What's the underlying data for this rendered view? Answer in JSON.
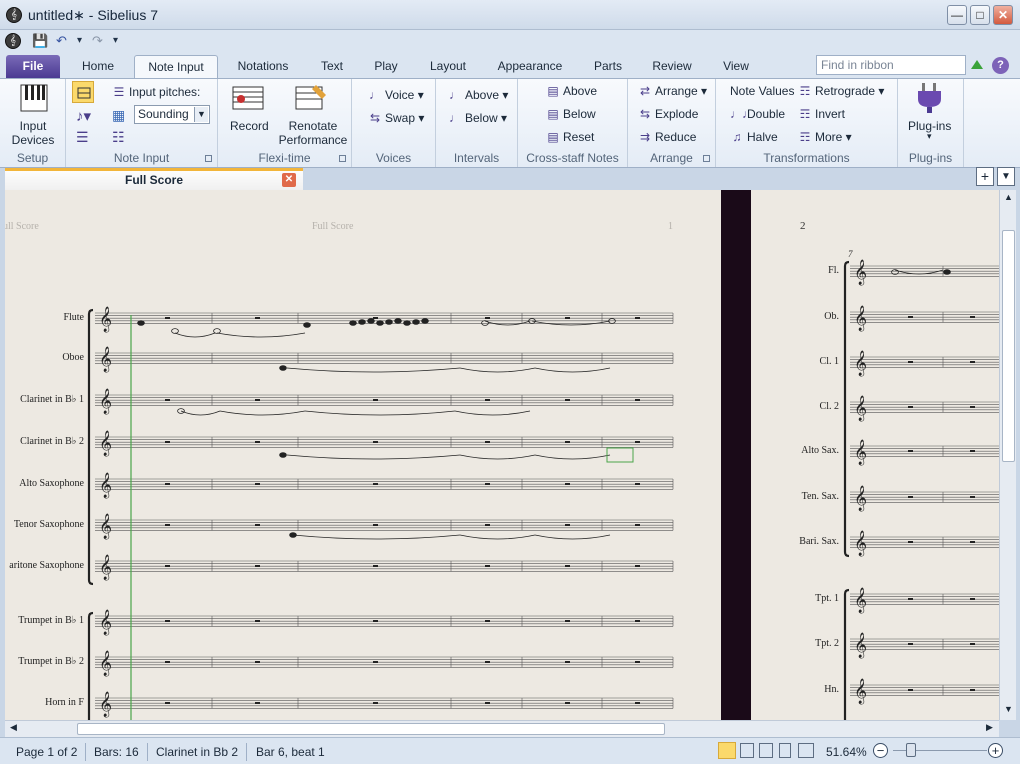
{
  "window": {
    "title": "untitled∗ - Sibelius 7",
    "minimize": "—",
    "maximize": "□",
    "close": "✕"
  },
  "qat": {
    "save": "💾",
    "undo": "↶",
    "redo": "↷",
    "dropdown": "▾"
  },
  "tabs": {
    "file": "File",
    "home": "Home",
    "note_input": "Note Input",
    "notations": "Notations",
    "text": "Text",
    "play": "Play",
    "layout": "Layout",
    "appearance": "Appearance",
    "parts": "Parts",
    "review": "Review",
    "view": "View"
  },
  "find": {
    "placeholder": "Find in ribbon"
  },
  "help": "?",
  "ribbon": {
    "setup": {
      "label": "Setup",
      "input_devices": "Input Devices"
    },
    "note_input": {
      "label": "Note Input",
      "input_pitches": "Input pitches:",
      "sounding": "Sounding"
    },
    "flexi": {
      "label": "Flexi-time",
      "record": "Record",
      "renotate": "Renotate Performance"
    },
    "voices": {
      "label": "Voices",
      "voice": "Voice",
      "swap": "Swap"
    },
    "intervals": {
      "label": "Intervals",
      "above": "Above",
      "below": "Below"
    },
    "cross_staff": {
      "label": "Cross-staff Notes",
      "above": "Above",
      "below": "Below",
      "reset": "Reset"
    },
    "arrange": {
      "label": "Arrange",
      "arrange": "Arrange",
      "explode": "Explode",
      "reduce": "Reduce"
    },
    "transformations": {
      "label": "Transformations",
      "note_values": "Note Values",
      "double": "Double",
      "halve": "Halve",
      "retrograde": "Retrograde",
      "invert": "Invert",
      "more": "More"
    },
    "plugins": {
      "label": "Plug-ins",
      "plugins": "Plug-ins"
    }
  },
  "doc_tab": {
    "title": "Full Score",
    "close": "✕"
  },
  "side": {
    "add": "+",
    "menu": "▼"
  },
  "score": {
    "page1_header_left": "ull Score",
    "page1_header_center": "Full Score",
    "page1_number": "1",
    "page2_number": "2",
    "bar_number": "7",
    "page1_instruments": [
      "Flute",
      "Oboe",
      "Clarinet in B♭ 1",
      "Clarinet in B♭ 2",
      "Alto Saxophone",
      "Tenor Saxophone",
      "aritone Saxophone",
      "Trumpet in B♭ 1",
      "Trumpet in B♭ 2",
      "Horn in F"
    ],
    "page2_instruments": [
      "Fl.",
      "Ob.",
      "Cl. 1",
      "Cl. 2",
      "Alto Sax.",
      "Ten. Sax.",
      "Bari. Sax.",
      "Tpt. 1",
      "Tpt. 2",
      "Hn."
    ]
  },
  "status": {
    "page": "Page 1 of 2",
    "bars": "Bars: 16",
    "instrument": "Clarinet in Bb 2",
    "position": "Bar 6, beat 1",
    "zoom": "51.64%",
    "zoom_out": "−",
    "zoom_in": "+"
  }
}
